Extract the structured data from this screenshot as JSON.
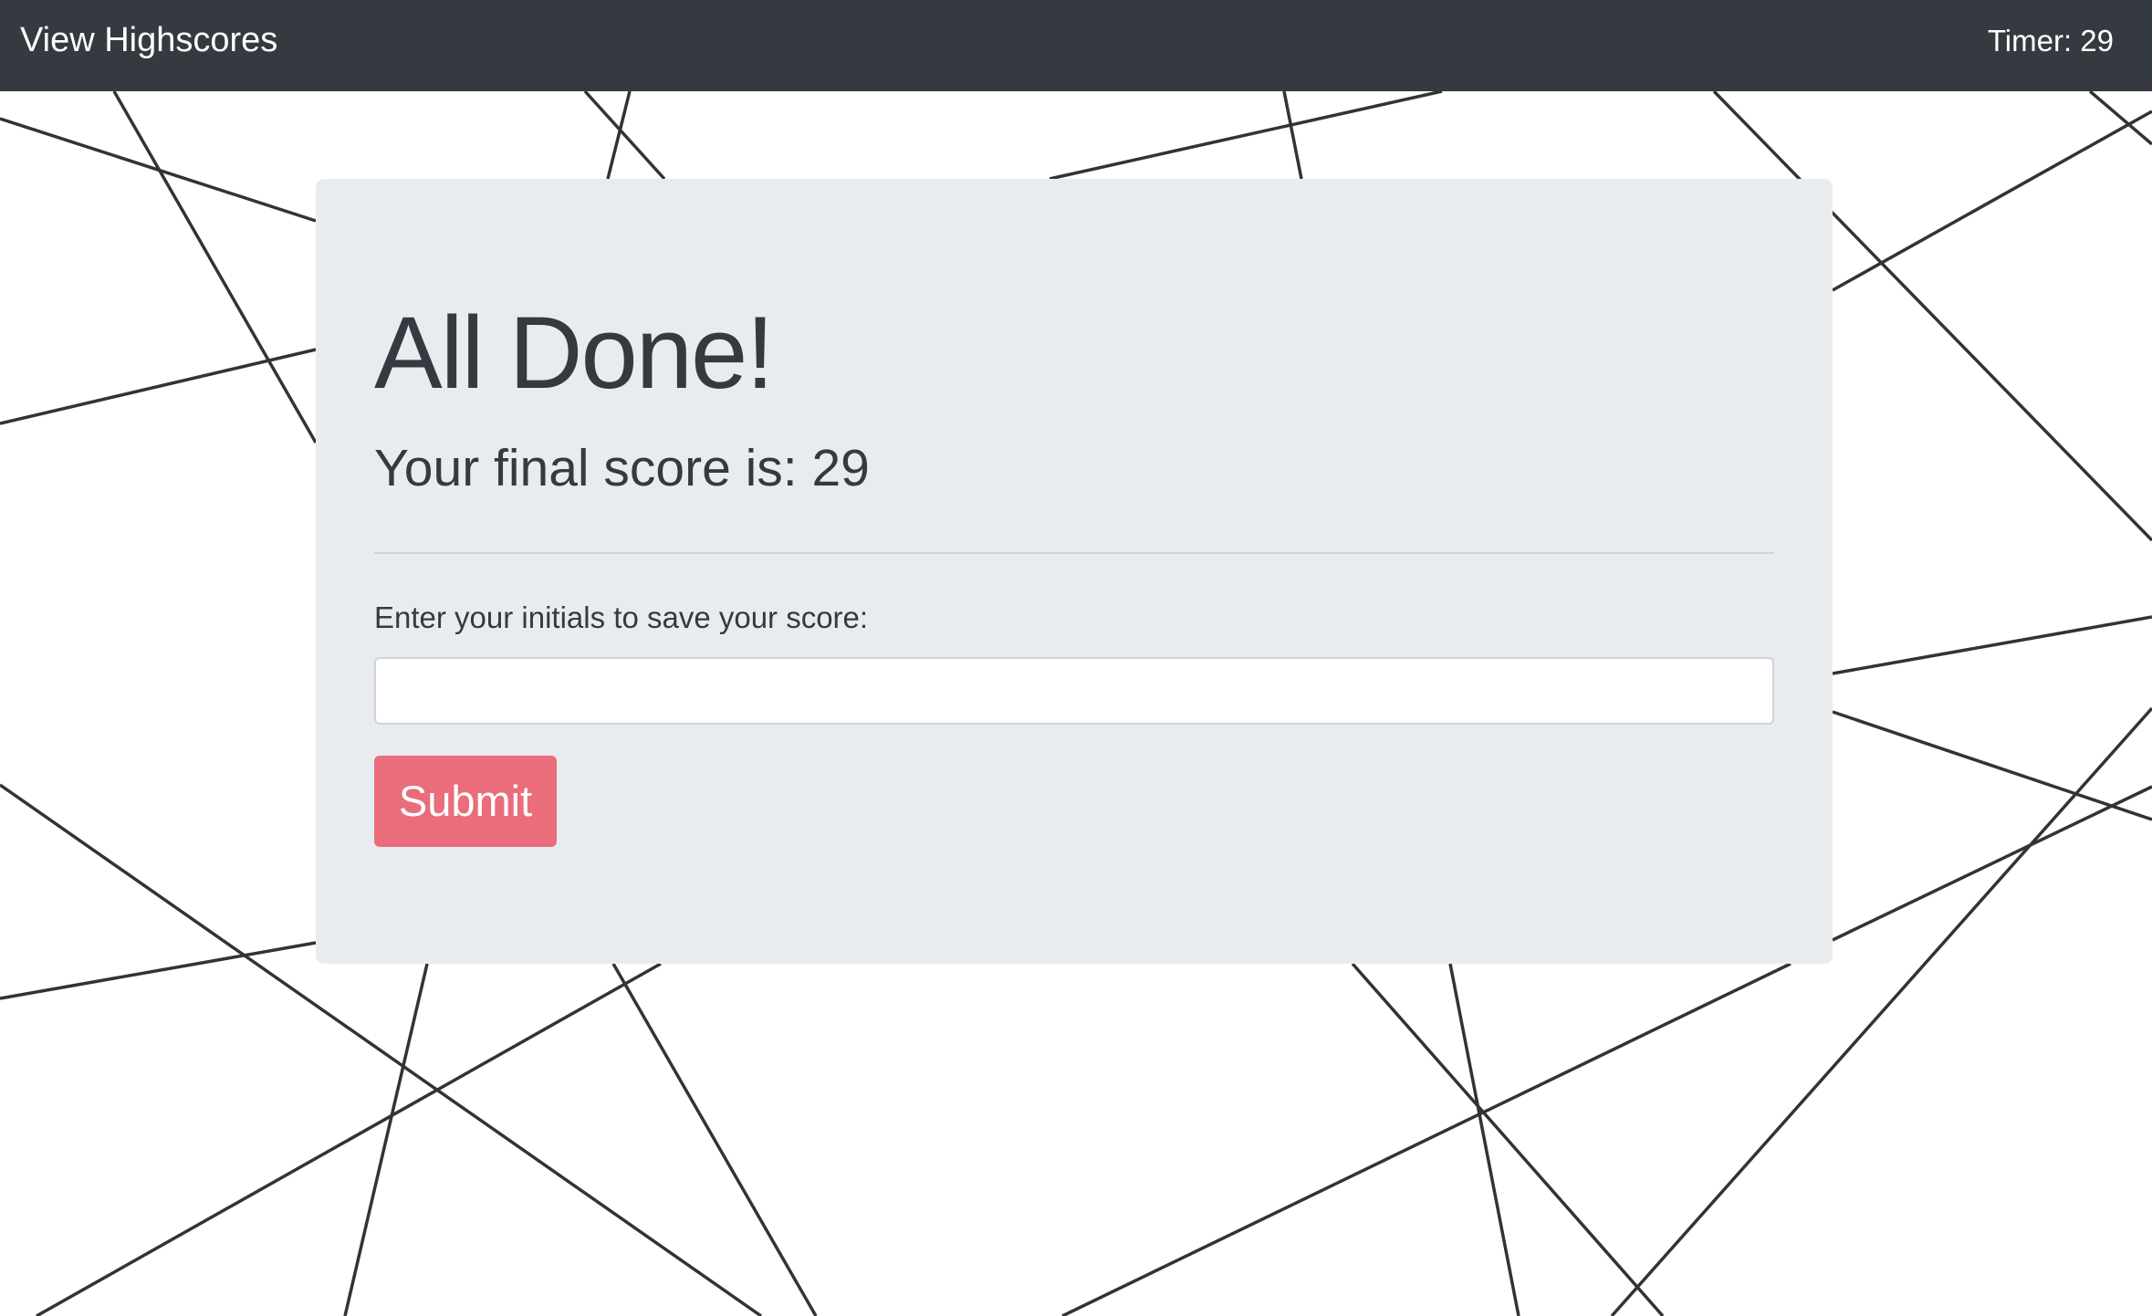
{
  "navbar": {
    "highscores_link": "View Highscores",
    "timer_label": "Timer: 29"
  },
  "quiz_end": {
    "title": "All Done!",
    "final_score_text": "Your final score is: 29",
    "initials_label": "Enter your initials to save your score:",
    "initials_value": "",
    "submit_label": "Submit"
  },
  "colors": {
    "navbar_bg": "#343a40",
    "card_bg": "#e9ecef",
    "submit_bg": "#e96d7b",
    "line_color": "#333333"
  }
}
